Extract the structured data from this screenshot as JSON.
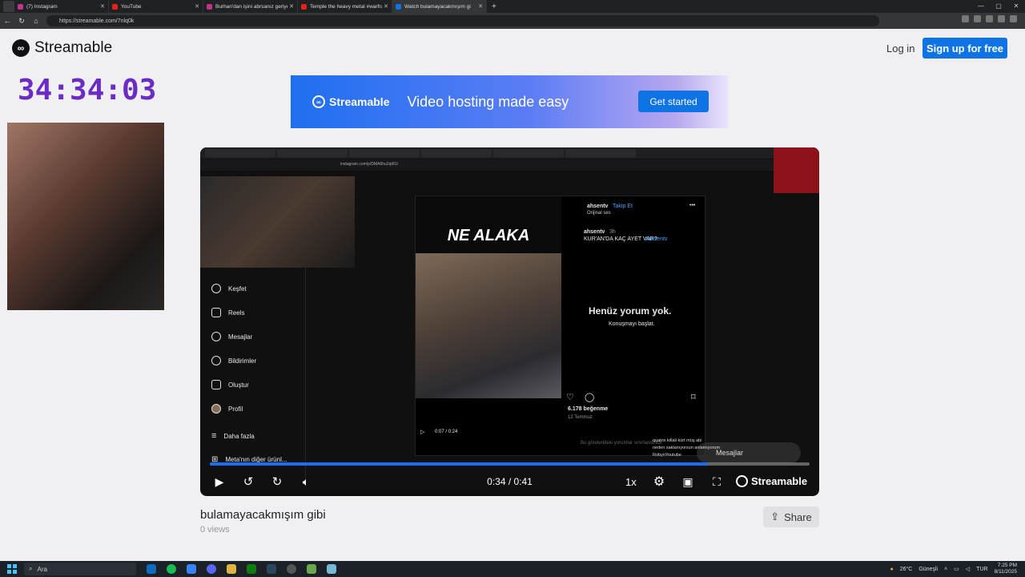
{
  "browser": {
    "tabs": [
      {
        "label": "(7) Instagram",
        "favcolor": "#c13584"
      },
      {
        "label": "YouTube",
        "favcolor": "#e62117"
      },
      {
        "label": "Burhan'dan işini abrsanız geriye n",
        "favcolor": "#c13584"
      },
      {
        "label": "Temple the heavy metal #warfran",
        "favcolor": "#e62117"
      },
      {
        "label": "Watch bulamayacakmışım gi",
        "favcolor": "#0e74e6"
      }
    ],
    "active_tab_index": 4,
    "url": "https://streamable.com/7nlq0k"
  },
  "header": {
    "logo_text": "Streamable",
    "login_label": "Log in",
    "signup_label": "Sign up for free"
  },
  "overlay": {
    "timer": "34:34:03"
  },
  "banner": {
    "logo_text": "Streamable",
    "tagline": "Video hosting made easy",
    "cta_label": "Get started"
  },
  "video_frame": {
    "inner_url": "instagram.com/p/DMA6hu2qiR1/",
    "ig_menu": [
      "Keşfet",
      "Reels",
      "Mesajlar",
      "Bildirimler",
      "Oluştur",
      "Profil",
      "Daha fazla",
      "Meta'nın diğer ürünl..."
    ],
    "reel_headline": "NE ALAKA",
    "account": "ahsentv",
    "follow_label": "Takip Et",
    "original_audio": "Orijinal ses",
    "caption_user": "ahsentv",
    "caption_time": "3h",
    "caption_text": "KUR'AN'DA KAÇ AYET VAR?",
    "caption_tag": "#ahsentv",
    "no_comments": "Henüz yorum yok.",
    "start_conversation": "Konuşmayı başlat.",
    "likes": "6.178 beğenme",
    "date": "12 Temmuz",
    "inner_time": "0:07 / 0:24",
    "comments_off_note": "Bu gönderideki yorumlar sınırlandırıldı",
    "messages_label": "Mesajlar",
    "chat_lines": [
      "quatrix killali kürt müş abi",
      "neden saklanıyorsun anlamıyorum",
      "RobynYoutube"
    ]
  },
  "player": {
    "current_time": "0:34 / 0:41",
    "progress_fraction": 0.83,
    "speed_label": "1x",
    "brand_label": "Streamable"
  },
  "video": {
    "title": "bulamayacakmışım gibi",
    "views": "0 views",
    "share_label": "Share"
  },
  "taskbar": {
    "search_placeholder": "Ara",
    "weather": "26°C",
    "weather_text": "Güneşli",
    "lang": "TUR",
    "time": "7:25 PM",
    "date": "8/11/2025"
  }
}
